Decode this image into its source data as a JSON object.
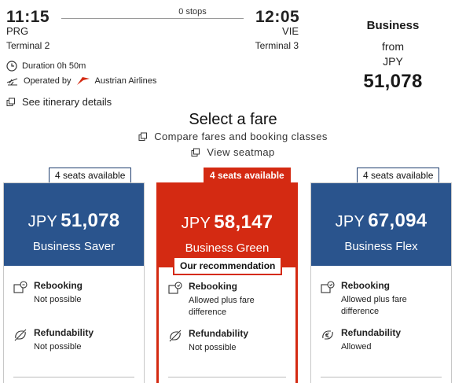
{
  "flight": {
    "departure": {
      "time": "11:15",
      "code": "PRG",
      "terminal": "Terminal 2"
    },
    "arrival": {
      "time": "12:05",
      "code": "VIE",
      "terminal": "Terminal 3"
    },
    "stops": "0 stops",
    "duration": "Duration 0h 50m",
    "operated_prefix": "Operated by",
    "airline": "Austrian Airlines",
    "itinerary_link": "See itinerary details"
  },
  "summary": {
    "cabin": "Business",
    "from": "from",
    "currency": "JPY",
    "price": "51,078"
  },
  "fare_select": {
    "heading": "Select a fare",
    "compare_link": "Compare fares and booking classes",
    "seatmap_link": "View seatmap"
  },
  "fares": [
    {
      "seats": "4 seats available",
      "currency": "JPY",
      "price": "51,078",
      "name": "Business Saver",
      "rebooking_title": "Rebooking",
      "rebooking_value": "Not possible",
      "refund_title": "Refundability",
      "refund_value": "Not possible"
    },
    {
      "seats": "4 seats available",
      "currency": "JPY",
      "price": "58,147",
      "name": "Business Green",
      "recommendation": "Our recommendation",
      "rebooking_title": "Rebooking",
      "rebooking_value_1": "Allowed plus fare",
      "rebooking_value_2": "difference",
      "refund_title": "Refundability",
      "refund_value": "Not possible"
    },
    {
      "seats": "4 seats available",
      "currency": "JPY",
      "price": "67,094",
      "name": "Business Flex",
      "rebooking_title": "Rebooking",
      "rebooking_value_1": "Allowed plus fare",
      "rebooking_value_2": "difference",
      "refund_title": "Refundability",
      "refund_value": "Allowed"
    }
  ],
  "colors": {
    "brand_blue": "#2a548d",
    "brand_red": "#d42a12"
  },
  "icons": {
    "duration": "clock-icon",
    "operated": "plane-icon",
    "airline_logo": "austrian-airlines-logo",
    "itinerary": "external-window-icon",
    "compare": "external-window-icon",
    "seatmap": "external-window-icon",
    "rebooking": "rebooking-icon",
    "refund_not": "no-refund-icon",
    "refund_allowed": "euro-refund-icon"
  }
}
